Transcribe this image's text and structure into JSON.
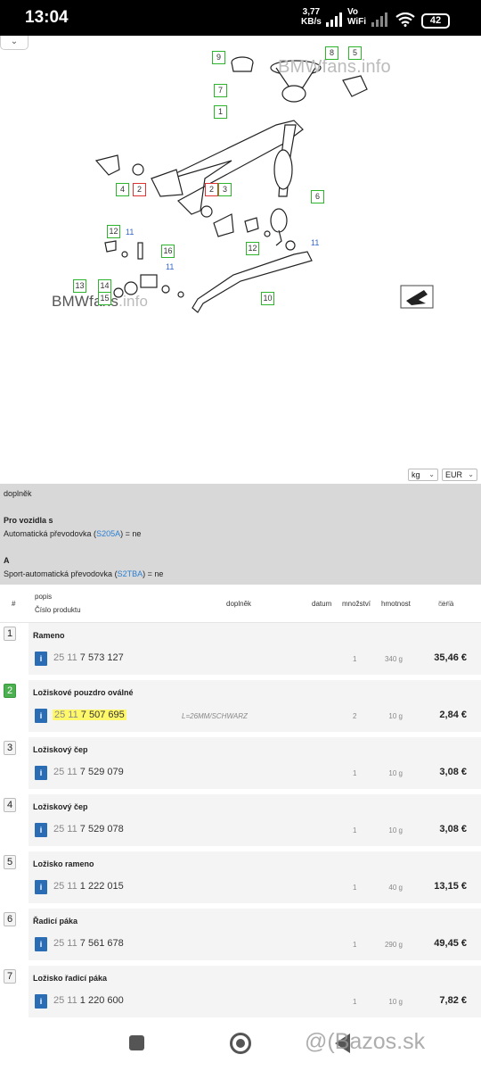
{
  "status": {
    "time": "13:04",
    "net_speed": "3,77",
    "net_unit": "KB/s",
    "vo": "Vo",
    "wifi": "WiFi",
    "battery": "42"
  },
  "diagram": {
    "collapse_icon": "chevron-down-icon",
    "watermark1": "BMWfans.info",
    "watermark2_dark": "BMWfans",
    "watermark2_light": ".info",
    "callouts": {
      "c9": "9",
      "c8": "8",
      "c5": "5",
      "c7": "7",
      "c1": "1",
      "c4": "4",
      "c2a": "2",
      "c2b": "2",
      "c3": "3",
      "c6": "6",
      "c12a": "12",
      "c16": "16",
      "c13": "13",
      "c14": "14",
      "c15": "15",
      "c12b": "12",
      "c10": "10"
    },
    "plain": {
      "p11a": "11",
      "p11b": "11",
      "p11c": "11"
    }
  },
  "units": {
    "weight": "kg",
    "currency": "EUR"
  },
  "filters": {
    "title": "doplněk",
    "group1_title": "Pro vozidla s",
    "group1_text": "Automatická převodovka (",
    "group1_code": "S205A",
    "group1_suffix": ") = ne",
    "group2_title": "A",
    "group2_text": "Sport-automatická převodovka (",
    "group2_code": "S2TBA",
    "group2_suffix": ") = ne"
  },
  "table": {
    "headers": {
      "num": "#",
      "popis": "popis",
      "cislo": "Číslo produktu",
      "doplnek": "doplněk",
      "datum": "datum",
      "mnozstvi": "množství",
      "hmotnost": "hmotnost",
      "cena": "cena",
      "cena_cur": "EUR"
    },
    "rows": [
      {
        "num": "1",
        "name": "Rameno",
        "prefix": "25 11",
        "number": "7 573 127",
        "note": "",
        "qty": "1",
        "weight": "340 g",
        "price": "35,46 €"
      },
      {
        "num": "2",
        "name": "Ložiskové pouzdro oválné",
        "prefix": "25 11",
        "number": "7 507 695",
        "note": "L=26MM/SCHWARZ",
        "qty": "2",
        "weight": "10 g",
        "price": "2,84 €"
      },
      {
        "num": "3",
        "name": "Ložiskový čep",
        "prefix": "25 11",
        "number": "7 529 079",
        "note": "",
        "qty": "1",
        "weight": "10 g",
        "price": "3,08 €"
      },
      {
        "num": "4",
        "name": "Ložiskový čep",
        "prefix": "25 11",
        "number": "7 529 078",
        "note": "",
        "qty": "1",
        "weight": "10 g",
        "price": "3,08 €"
      },
      {
        "num": "5",
        "name": "Ložisko rameno",
        "prefix": "25 11",
        "number": "1 222 015",
        "note": "",
        "qty": "1",
        "weight": "40 g",
        "price": "13,15 €"
      },
      {
        "num": "6",
        "name": "Řadicí páka",
        "prefix": "25 11",
        "number": "7 561 678",
        "note": "",
        "qty": "1",
        "weight": "290 g",
        "price": "49,45 €"
      },
      {
        "num": "7",
        "name": "Ložisko řadicí páka",
        "prefix": "25 11",
        "number": "1 220 600",
        "note": "",
        "qty": "1",
        "weight": "10 g",
        "price": "7,82 €"
      }
    ],
    "info_label": "i"
  },
  "watermark_bazos": "@(Bazos.sk"
}
